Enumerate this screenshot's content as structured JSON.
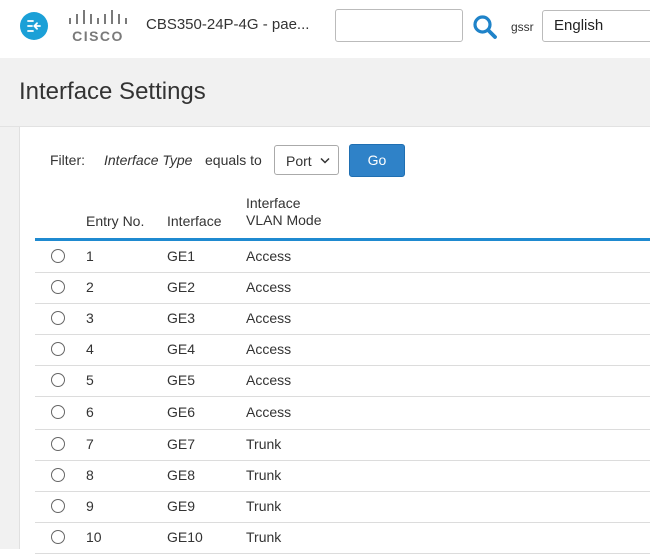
{
  "header": {
    "device_name": "CBS350-24P-4G - pae...",
    "logo_text": "CISCO",
    "search_value": "",
    "user": "gssr",
    "language": "English"
  },
  "page": {
    "title": "Interface Settings"
  },
  "filter": {
    "label": "Filter:",
    "field": "Interface Type",
    "operator": "equals to",
    "selected": "Port",
    "go_label": "Go"
  },
  "table": {
    "columns": [
      "Entry No.",
      "Interface",
      "Interface",
      "VLAN Mode"
    ],
    "rows": [
      {
        "entry": "1",
        "interface": "GE1",
        "mode": "Access"
      },
      {
        "entry": "2",
        "interface": "GE2",
        "mode": "Access"
      },
      {
        "entry": "3",
        "interface": "GE3",
        "mode": "Access"
      },
      {
        "entry": "4",
        "interface": "GE4",
        "mode": "Access"
      },
      {
        "entry": "5",
        "interface": "GE5",
        "mode": "Access"
      },
      {
        "entry": "6",
        "interface": "GE6",
        "mode": "Access"
      },
      {
        "entry": "7",
        "interface": "GE7",
        "mode": "Trunk"
      },
      {
        "entry": "8",
        "interface": "GE8",
        "mode": "Trunk"
      },
      {
        "entry": "9",
        "interface": "GE9",
        "mode": "Trunk"
      },
      {
        "entry": "10",
        "interface": "GE10",
        "mode": "Trunk"
      }
    ]
  },
  "colors": {
    "accent": "#1ba0d7",
    "button": "#2f82c8",
    "rule": "#1f8ad0"
  }
}
